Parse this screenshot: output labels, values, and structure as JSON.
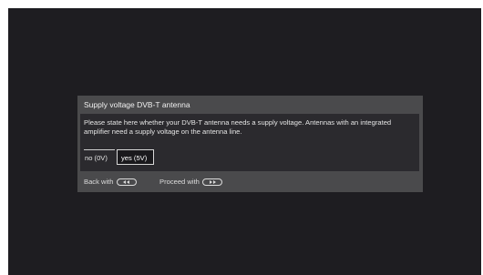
{
  "dialog": {
    "title": "Supply voltage DVB-T antenna",
    "message": "Please state here whether your DVB-T antenna needs a supply voltage. Antennas with an integrated amplifier need a supply voltage on the antenna line.",
    "options": [
      {
        "label": "no (0V)",
        "selected": false
      },
      {
        "label": "yes (5V)",
        "selected": true
      }
    ],
    "footer": {
      "back_label": "Back with",
      "back_icon": "rewind-key-icon",
      "proceed_label": "Proceed with",
      "proceed_icon": "fast-forward-key-icon"
    }
  },
  "colors": {
    "screen_background": "#1e1d21",
    "dialog_background": "#4a4a4c",
    "body_background": "#2b2a2e",
    "text": "#e4e4e4"
  }
}
